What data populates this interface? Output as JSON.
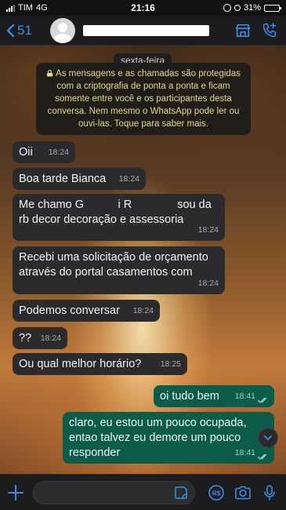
{
  "status_bar": {
    "carrier": "TIM",
    "network": "4G",
    "time": "21:16",
    "battery": "31%",
    "battery_level": 0.31
  },
  "header": {
    "back_count": "51",
    "icons": [
      "chevron-left-icon",
      "storefront-icon",
      "add-call-icon"
    ]
  },
  "chat": {
    "day_label": "sexta-feira",
    "encryption_notice": "As mensagens e as chamadas são protegidas com a criptografia de ponta a ponta e ficam somente entre você e os participantes desta conversa. Nem mesmo o WhatsApp pode ler ou ouvi-las. Toque para saber mais.",
    "messages": [
      {
        "direction": "in",
        "text": "Oii",
        "time": "18:24"
      },
      {
        "direction": "in",
        "text": "Boa tarde Bianca",
        "time": "18:24"
      },
      {
        "direction": "in",
        "text": "Me chamo G   i R    sou da rb decor decoração e assessoria",
        "time": "18:24"
      },
      {
        "direction": "in",
        "text": "Recebi uma solicitação de orçamento através do portal casamentos com",
        "time": "18:24"
      },
      {
        "direction": "in",
        "text": "Podemos conversar",
        "time": "18:24"
      },
      {
        "direction": "in",
        "text": "??",
        "time": "18:24"
      },
      {
        "direction": "in",
        "text": "Ou qual melhor horário?",
        "time": "18:25"
      },
      {
        "direction": "out",
        "text": "oi tudo bem",
        "time": "18:41"
      },
      {
        "direction": "out",
        "text": "claro, eu estou um pouco ocupada, entao talvez eu demore um pouco responder",
        "time": "18:41"
      }
    ]
  },
  "composer": {
    "icons": [
      "plus-icon",
      "sticker-icon",
      "pix-icon",
      "camera-icon",
      "microphone-icon"
    ],
    "pix_label": "R$"
  },
  "colors": {
    "incoming_bubble": "#2b2b2d",
    "outgoing_bubble": "#0b5c4a",
    "accent": "#3a8ee8",
    "notice_text": "#e9d78a"
  }
}
